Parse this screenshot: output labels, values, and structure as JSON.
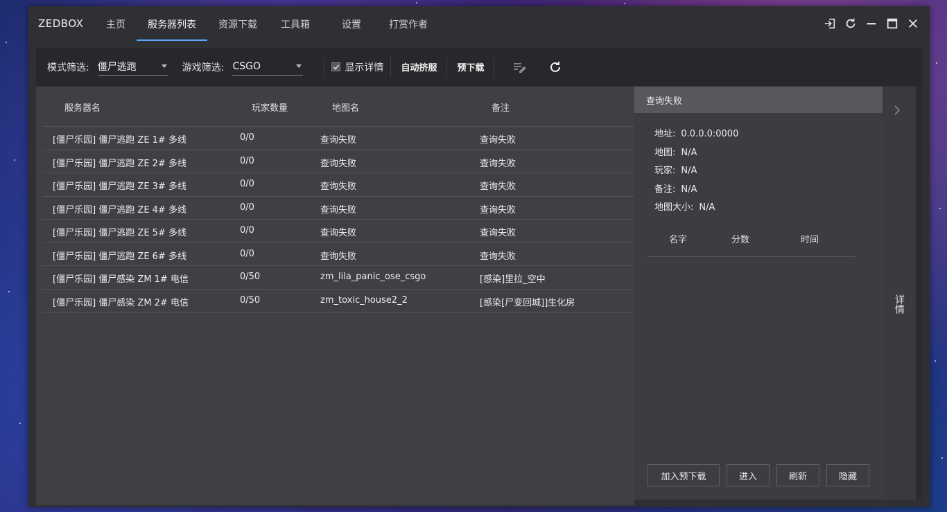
{
  "app": {
    "title": "ZEDBOX"
  },
  "nav": {
    "tabs": [
      {
        "label": "主页"
      },
      {
        "label": "服务器列表",
        "active": true
      },
      {
        "label": "资源下载"
      },
      {
        "label": "工具箱"
      },
      {
        "label": "设置"
      },
      {
        "label": "打赏作者"
      }
    ]
  },
  "window_controls": [
    "login-icon",
    "refresh-icon",
    "minimize-icon",
    "maximize-icon",
    "close-icon"
  ],
  "toolbar": {
    "mode_filter_label": "模式筛选:",
    "mode_filter_value": "僵尸逃跑",
    "game_filter_label": "游戏筛选:",
    "game_filter_value": "CSGO",
    "show_details_label": "显示详情",
    "show_details_checked": true,
    "auto_join_label": "自动挤服",
    "predownload_label": "预下载",
    "icons": [
      "edit-list-icon",
      "reload-icon"
    ]
  },
  "table": {
    "headers": {
      "name": "服务器名",
      "players": "玩家数量",
      "map": "地图名",
      "note": "备注"
    },
    "rows": [
      {
        "name": "[僵尸乐园] 僵尸逃跑 ZE 1# 多线",
        "players": "0/0",
        "map": "查询失败",
        "note": "查询失败"
      },
      {
        "name": "[僵尸乐园] 僵尸逃跑 ZE 2# 多线",
        "players": "0/0",
        "map": "查询失败",
        "note": "查询失败"
      },
      {
        "name": "[僵尸乐园] 僵尸逃跑 ZE 3# 多线",
        "players": "0/0",
        "map": "查询失败",
        "note": "查询失败"
      },
      {
        "name": "[僵尸乐园] 僵尸逃跑 ZE 4# 多线",
        "players": "0/0",
        "map": "查询失败",
        "note": "查询失败"
      },
      {
        "name": "[僵尸乐园] 僵尸逃跑 ZE 5# 多线",
        "players": "0/0",
        "map": "查询失败",
        "note": "查询失败"
      },
      {
        "name": "[僵尸乐园] 僵尸逃跑 ZE 6# 多线",
        "players": "0/0",
        "map": "查询失败",
        "note": "查询失败"
      },
      {
        "name": "[僵尸乐园] 僵尸感染 ZM 1# 电信",
        "players": "0/50",
        "map": "zm_lila_panic_ose_csgo",
        "note": "[感染]里拉_空中"
      },
      {
        "name": "[僵尸乐园] 僵尸感染 ZM 2# 电信",
        "players": "0/50",
        "map": "zm_toxic_house2_2",
        "note": "[感染[尸变回城]]生化房"
      }
    ]
  },
  "detail": {
    "title": "查询失败",
    "address_label": "地址:",
    "address_value": "0.0.0.0:0000",
    "map_label": "地图:",
    "map_value": "N/A",
    "players_label": "玩家:",
    "players_value": "N/A",
    "note_label": "备注:",
    "note_value": "N/A",
    "mapsize_label": "地图大小:",
    "mapsize_value": "N/A",
    "player_headers": {
      "name": "名字",
      "score": "分数",
      "time": "时间"
    },
    "buttons": {
      "predownload": "加入预下载",
      "join": "进入",
      "refresh": "刷新",
      "hide": "隐藏"
    }
  },
  "side_strip": {
    "label": "详情"
  }
}
